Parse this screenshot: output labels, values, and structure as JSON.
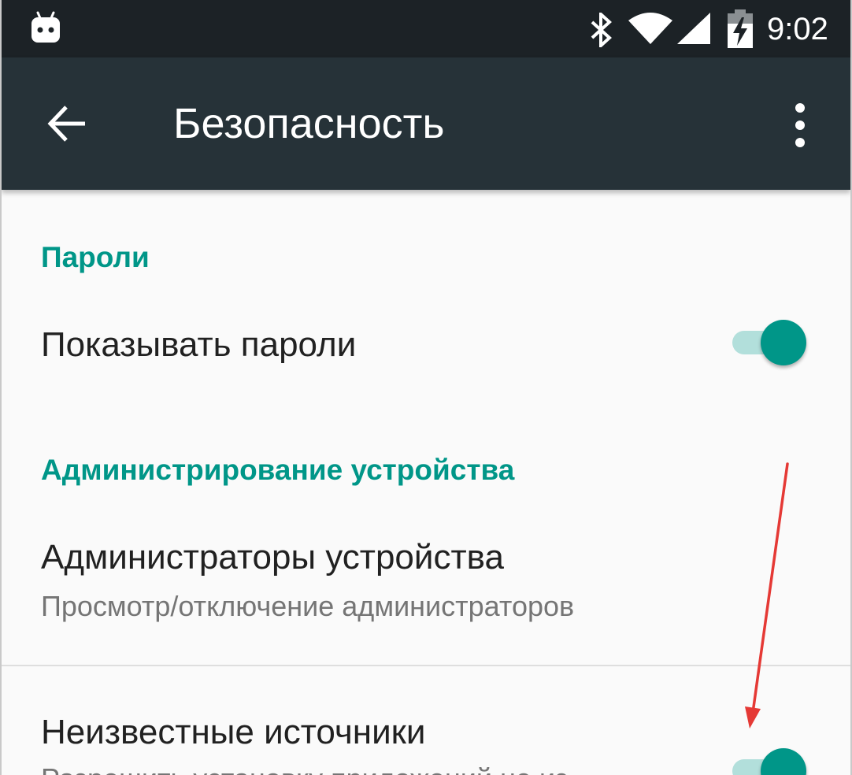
{
  "status_bar": {
    "time": "9:02",
    "icons": [
      "android-icon",
      "bluetooth-icon",
      "wifi-icon",
      "signal-icon",
      "battery-charging-icon"
    ]
  },
  "toolbar": {
    "title": "Безопасность",
    "back_icon": "arrow-back-icon",
    "menu_icon": "more-vert-icon"
  },
  "sections": {
    "passwords": {
      "header": "Пароли",
      "show_passwords": {
        "title": "Показывать пароли",
        "enabled": true
      }
    },
    "device_admin": {
      "header": "Администрирование устройства",
      "admins": {
        "title": "Администраторы устройства",
        "summary": "Просмотр/отключение администраторов"
      },
      "unknown_sources": {
        "title": "Неизвестные источники",
        "summary": "Разрешить установку приложений не из",
        "enabled": true
      }
    }
  },
  "colors": {
    "status_bar": "#1c2226",
    "toolbar": "#263238",
    "accent": "#009688",
    "switch_track": "#b2dfdb",
    "background": "#fafafa",
    "annotation_arrow": "#e53935"
  }
}
